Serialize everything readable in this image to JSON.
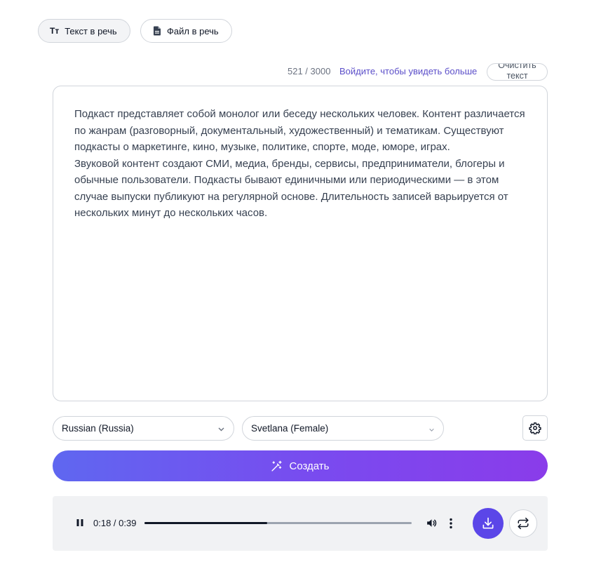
{
  "tabs": {
    "text_to_speech": "Текст в речь",
    "file_to_speech": "Файл в речь",
    "text_icon_glyph": "Tт"
  },
  "editor": {
    "counter": "521 / 3000",
    "signin_link": "Войдите, чтобы увидеть больше",
    "clear_label": "Очистить текст",
    "text": "Подкаст представляет собой монолог или беседу нескольких человек. Контент различается по жанрам (разговорный, документальный, художественный) и тематикам. Существуют подкасты о маркетинге, кино, музыке, политике, спорте, моде, юморе, играх.\nЗвуковой контент создают СМИ, медиа, бренды, сервисы, предприниматели, блогеры и обычные пользователи. Подкасты бывают единичными или периодическими — в этом случае выпуски публикуют на регулярной основе. Длительность записей варьируется от нескольких минут до нескольких часов."
  },
  "options": {
    "language": "Russian (Russia)",
    "voice": "Svetlana (Female)"
  },
  "create_label": "Создать",
  "player": {
    "time": "0:18 / 0:39",
    "progress": 0.46
  },
  "colors": {
    "accent": "#5b46e8",
    "link": "#5b4ec9",
    "gradient_start": "#5f67f0",
    "gradient_end": "#8a3cea"
  },
  "icons": {
    "text_tab": "text-size-icon",
    "file_tab": "file-icon",
    "settings": "gear-icon",
    "create": "magic-wand-icon",
    "pause": "pause-icon",
    "volume": "volume-icon",
    "more": "more-vertical-icon",
    "download": "download-icon",
    "repeat": "repeat-icon"
  }
}
